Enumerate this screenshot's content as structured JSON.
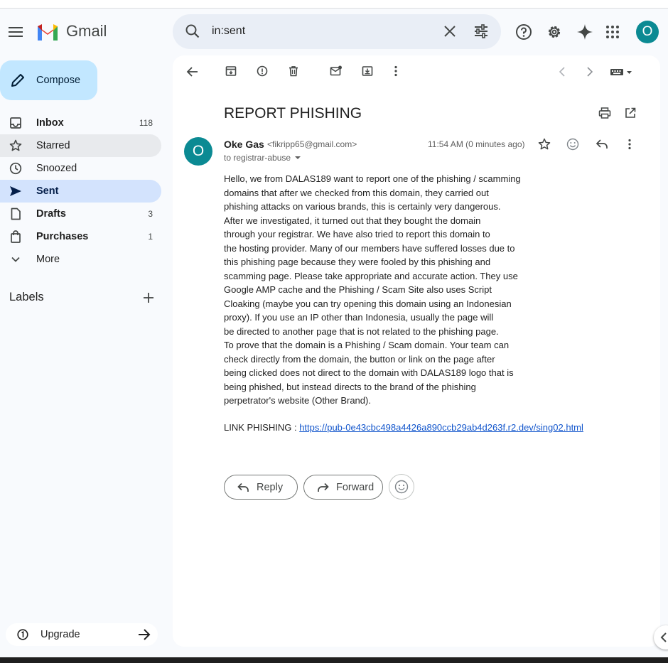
{
  "app": {
    "name": "Gmail"
  },
  "search": {
    "query": "in:sent"
  },
  "account": {
    "initial": "O"
  },
  "sidebar": {
    "compose_label": "Compose",
    "items": [
      {
        "label": "Inbox",
        "count": "118"
      },
      {
        "label": "Starred",
        "count": ""
      },
      {
        "label": "Snoozed",
        "count": ""
      },
      {
        "label": "Sent",
        "count": ""
      },
      {
        "label": "Drafts",
        "count": "3"
      },
      {
        "label": "Purchases",
        "count": "1"
      },
      {
        "label": "More",
        "count": ""
      }
    ],
    "labels_title": "Labels",
    "upgrade_label": "Upgrade"
  },
  "email": {
    "subject": "REPORT PHISHING",
    "sender_initial": "O",
    "sender_name": "Oke Gas",
    "sender_email": "<fikripp65@gmail.com>",
    "to": "to registrar-abuse",
    "time": "11:54 AM (0 minutes ago)",
    "body_lines": [
      "Hello, we from DALAS189  want to report one of the phishing / scamming",
      "domains that after we checked from this domain, they carried out",
      "phishing attacks on various brands, this is certainly very dangerous.",
      "After we investigated, it turned out that they bought the domain",
      "through your registrar. We have also tried to report this domain to",
      "the hosting provider. Many of our members have suffered losses due to",
      "this phishing page because they were fooled by this phishing and",
      "scamming page. Please take appropriate and accurate action. They use",
      "Google AMP cache and the Phishing / Scam Site also uses Script",
      "Cloaking (maybe you can try opening this domain using an Indonesian",
      "proxy). If you use an IP other than Indonesia, usually the page will",
      "be directed to another page that is not related to the phishing page.",
      "To prove that the domain is a Phishing / Scam domain. Your team can",
      "check directly from the domain, the button or link on the page after",
      "being clicked does not direct to the domain with DALAS189 logo that is",
      "being phished, but instead directs to the brand of the phishing",
      "perpetrator's website (Other Brand)."
    ],
    "link_prefix": "LINK PHISHING : ",
    "link_url": "https://pub-0e43cbc498a4426a890ccb29ab4d263f.r2.dev/sing02.html",
    "reply_label": "Reply",
    "forward_label": "Forward"
  },
  "colors": {
    "accent_blue": "#d3e3fd",
    "compose_bg": "#c2e7ff",
    "avatar_teal": "#0b8a93",
    "link": "#1155cc"
  }
}
